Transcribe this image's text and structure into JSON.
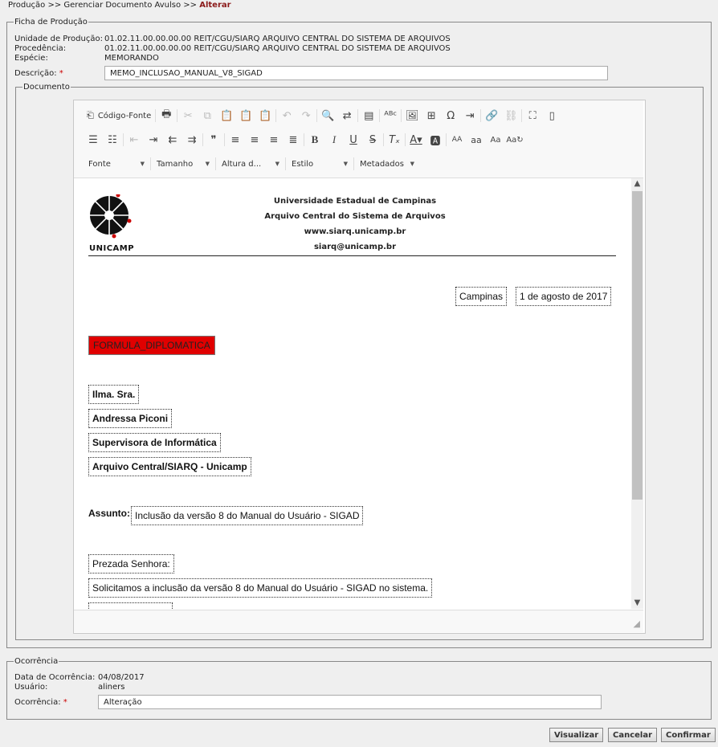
{
  "breadcrumb": {
    "path": "Produção >> Gerenciar Documento Avulso >>",
    "current": "Alterar"
  },
  "ficha": {
    "legend": "Ficha de Produção",
    "unidade_label": "Unidade de Produção:",
    "unidade_value": "01.02.11.00.00.00.00 REIT/CGU/SIARQ ARQUIVO CENTRAL DO SISTEMA DE ARQUIVOS",
    "procedencia_label": "Procedência:",
    "procedencia_value": "01.02.11.00.00.00.00 REIT/CGU/SIARQ ARQUIVO CENTRAL DO SISTEMA DE ARQUIVOS",
    "especie_label": "Espécie:",
    "especie_value": "MEMORANDO",
    "descricao_label": "Descrição:",
    "descricao_value": "MEMO_INCLUSAO_MANUAL_V8_SIGAD",
    "required_mark": "*"
  },
  "documento": {
    "legend": "Documento",
    "toolbar": {
      "source_label": "Código-Fonte",
      "combos": [
        "Fonte",
        "Tamanho",
        "Altura d...",
        "Estilo",
        "Metadados"
      ]
    },
    "header": {
      "line1": "Universidade Estadual de Campinas",
      "line2": "Arquivo Central do Sistema de Arquivos",
      "line3": "www.siarq.unicamp.br",
      "line4": "siarq@unicamp.br",
      "logo_text": "UNICAMP"
    },
    "city": "Campinas",
    "date": "1 de agosto de 2017",
    "formula": "FORMULA_DIPLOMATICA",
    "recipient": [
      "Ilma. Sra.",
      "Andressa Piconi",
      "Supervisora de Informática",
      "Arquivo Central/SIARQ - Unicamp"
    ],
    "assunto_label": "Assunto:",
    "assunto_value": "Inclusão da versão 8 do Manual do Usuário - SIGAD",
    "salutation": "Prezada Senhora:",
    "body": "Solicitamos a inclusão da versão 8 do Manual do Usuário - SIGAD no sistema."
  },
  "ocorrencia": {
    "legend": "Ocorrência",
    "data_label": "Data de Ocorrência:",
    "data_value": "04/08/2017",
    "usuario_label": "Usuário:",
    "usuario_value": "aliners",
    "ocorrencia_label": "Ocorrência:",
    "ocorrencia_value": "Alteração"
  },
  "buttons": {
    "visualizar": "Visualizar",
    "cancelar": "Cancelar",
    "confirmar": "Confirmar"
  },
  "colors": {
    "formula_bg": "#e00000",
    "breadcrumb_current": "#8b1a1a",
    "required": "#cc0000"
  }
}
